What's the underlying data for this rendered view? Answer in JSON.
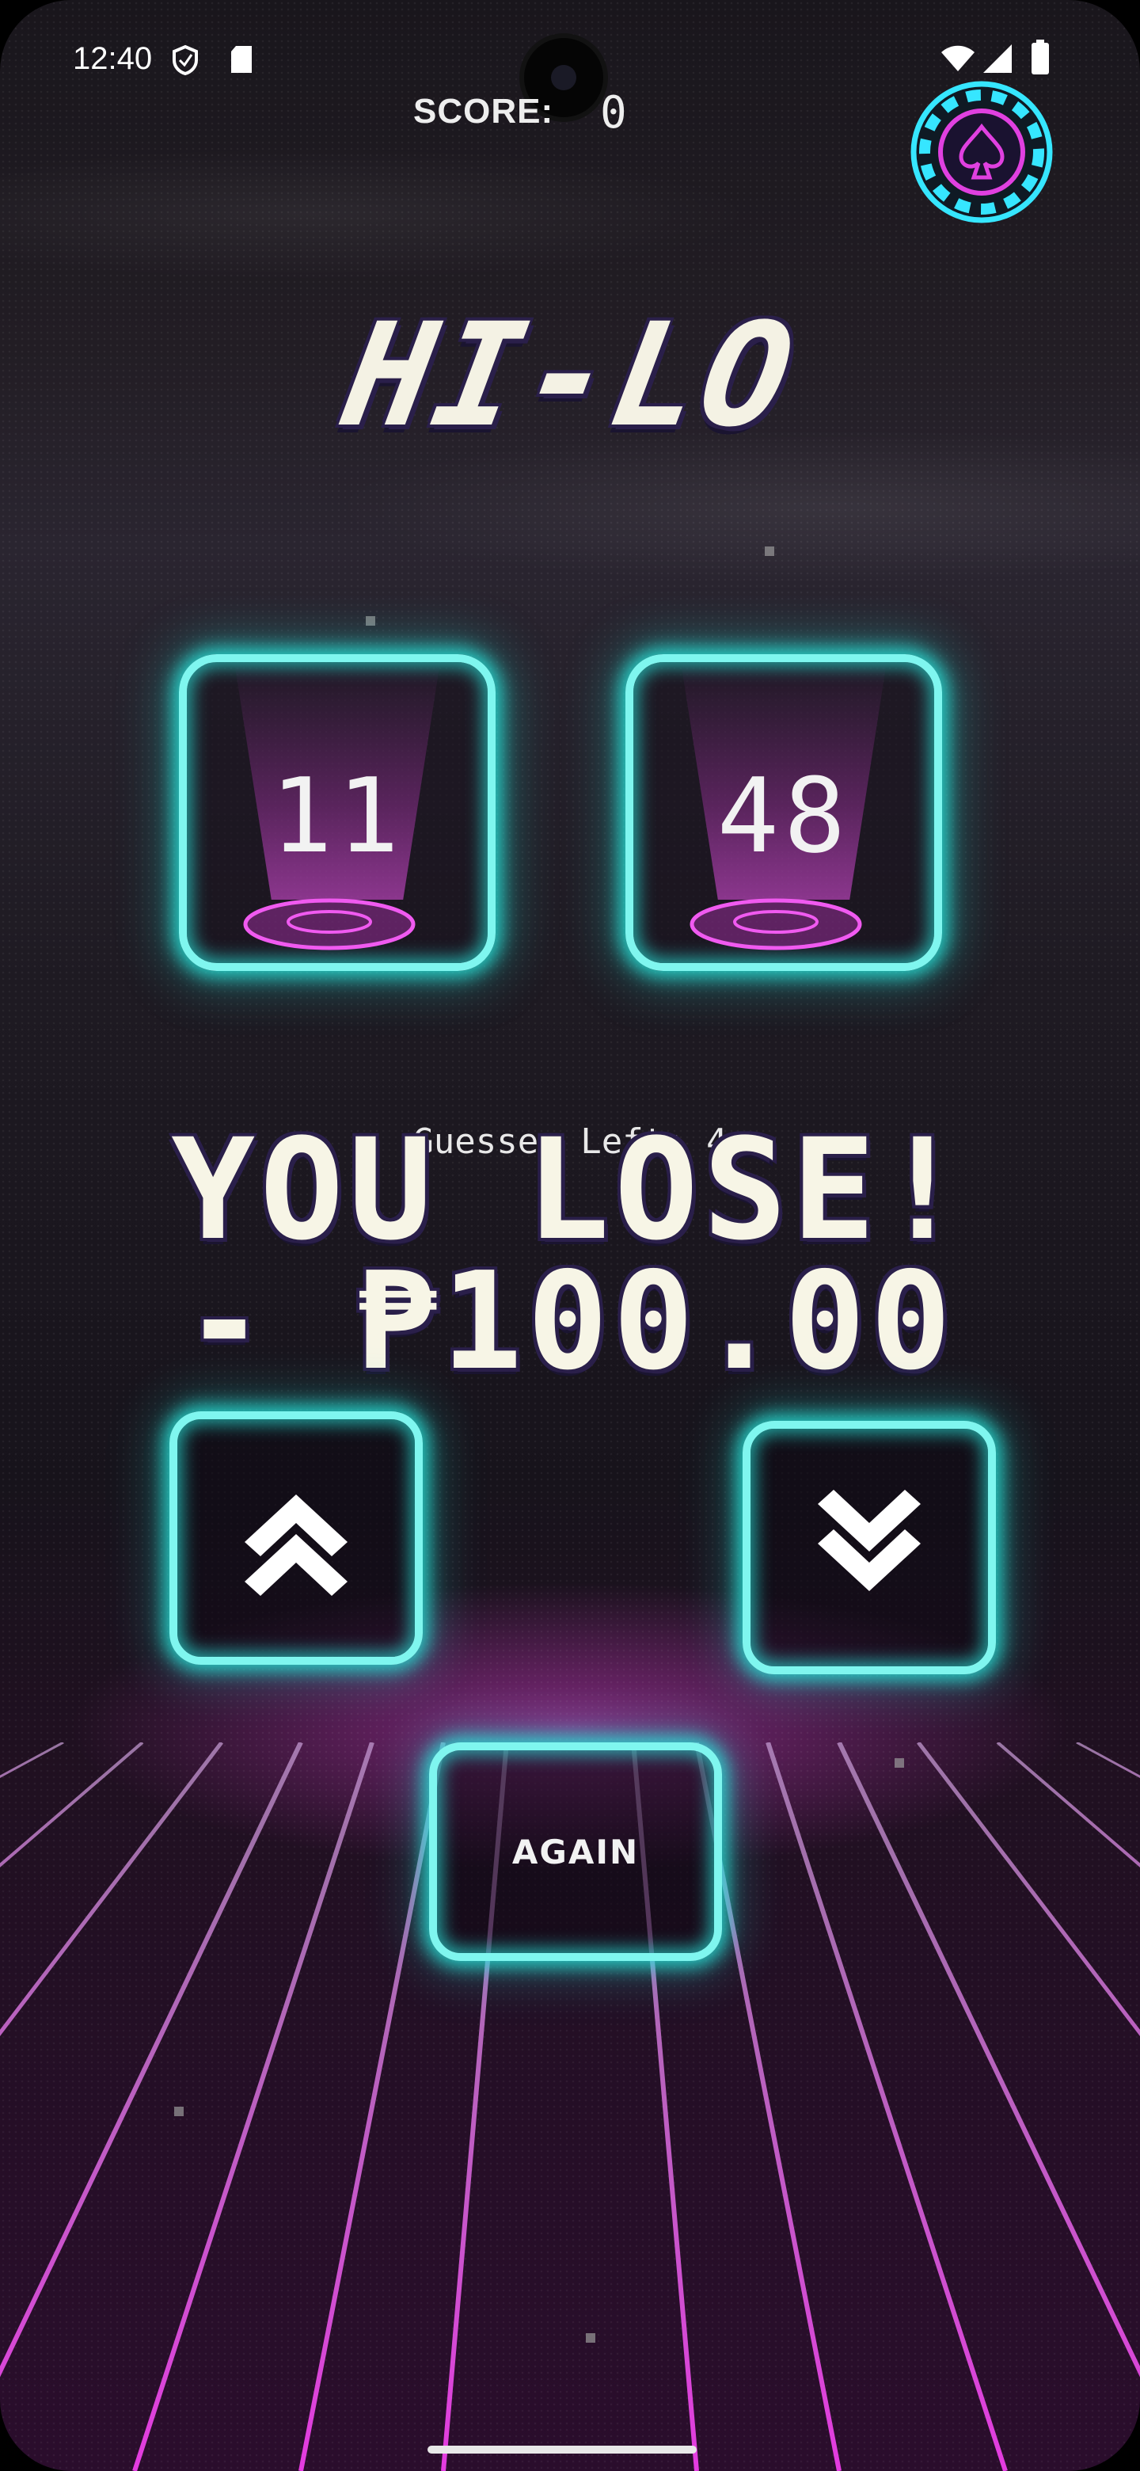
{
  "status_bar": {
    "time": "12:40"
  },
  "score": {
    "label": "SCORE:",
    "value": "0"
  },
  "title": "HI-LO",
  "cards": [
    {
      "value": "11"
    },
    {
      "value": "48"
    }
  ],
  "guesses_left_label": "Guesses Left: 4",
  "result": {
    "line1": "YOU LOSE!",
    "line2": "- ₱100.00"
  },
  "buttons": {
    "again": "AGAIN"
  },
  "icons": [
    "shield-icon",
    "sd-card-icon",
    "wifi-icon",
    "signal-icon",
    "battery-icon",
    "poker-chip-icon",
    "chevron-up-double-icon",
    "chevron-down-double-icon"
  ],
  "colors": {
    "neon_cyan": "#7ff6ef",
    "neon_magenta": "#e040e0",
    "text_cream": "#f4f2e4",
    "outline_purple": "#2a1f4a"
  }
}
